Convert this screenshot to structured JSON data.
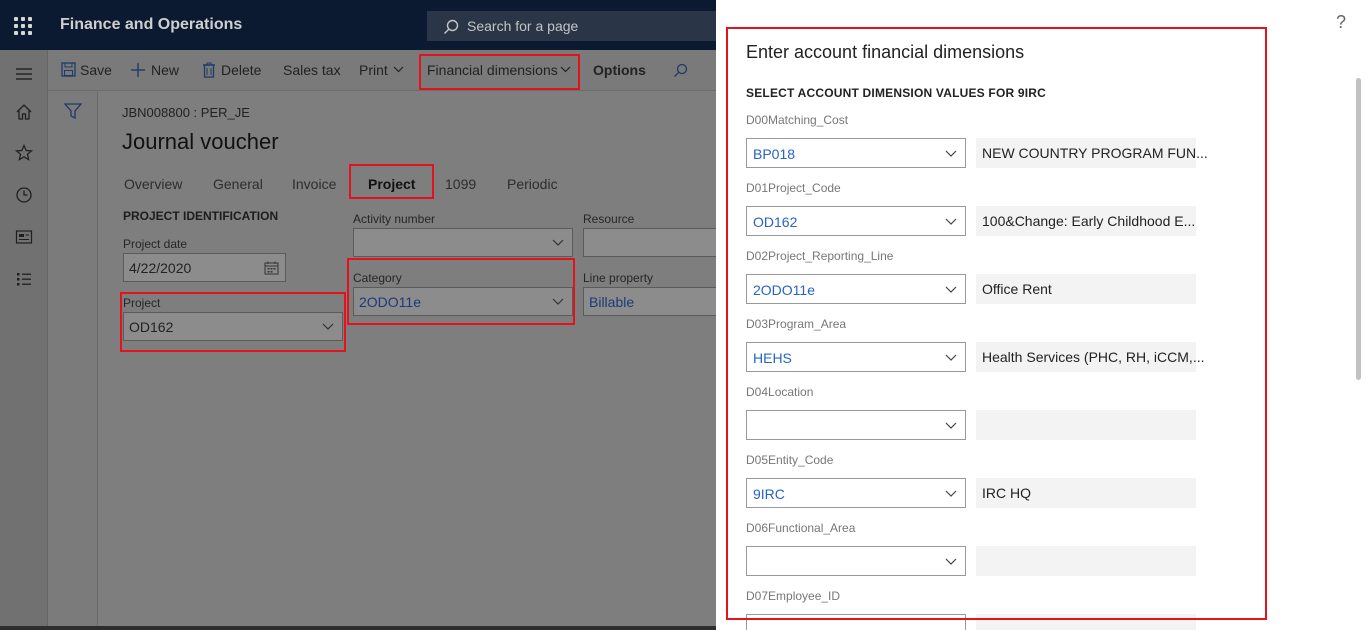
{
  "app": {
    "title": "Finance and Operations",
    "search_placeholder": "Search for a page"
  },
  "toolbar": {
    "save": "Save",
    "new": "New",
    "delete": "Delete",
    "sales_tax": "Sales tax",
    "print": "Print",
    "financial_dimensions": "Financial dimensions",
    "options": "Options"
  },
  "page": {
    "breadcrumb": "JBN008800 : PER_JE",
    "title": "Journal voucher",
    "tabs": [
      "Overview",
      "General",
      "Invoice",
      "Project",
      "1099",
      "Periodic"
    ],
    "active_tab": "Project",
    "section": "PROJECT IDENTIFICATION",
    "fields": {
      "project_date_label": "Project date",
      "project_date": "4/22/2020",
      "project_label": "Project",
      "project": "OD162",
      "activity_label": "Activity number",
      "activity": "",
      "category_label": "Category",
      "category": "2ODO11e",
      "resource_label": "Resource",
      "resource": "",
      "line_property_label": "Line property",
      "line_property": "Billable"
    }
  },
  "flyout": {
    "help": "?",
    "title": "Enter account financial dimensions",
    "subtitle": "SELECT ACCOUNT DIMENSION VALUES FOR 9IRC",
    "dimensions": [
      {
        "label": "D00Matching_Cost",
        "value": "BP018",
        "description": "NEW COUNTRY PROGRAM FUN..."
      },
      {
        "label": "D01Project_Code",
        "value": "OD162",
        "description": "100&Change: Early Childhood E..."
      },
      {
        "label": "D02Project_Reporting_Line",
        "value": "2ODO11e",
        "description": "Office Rent"
      },
      {
        "label": "D03Program_Area",
        "value": "HEHS",
        "description": "Health Services (PHC, RH, iCCM,..."
      },
      {
        "label": "D04Location",
        "value": "",
        "description": ""
      },
      {
        "label": "D05Entity_Code",
        "value": "9IRC",
        "description": "IRC HQ"
      },
      {
        "label": "D06Functional_Area",
        "value": "",
        "description": ""
      },
      {
        "label": "D07Employee_ID",
        "value": "",
        "description": ""
      }
    ]
  },
  "colors": {
    "topbar": "#0c1a31",
    "highlight": "#e3121b",
    "link": "#2564c6"
  }
}
